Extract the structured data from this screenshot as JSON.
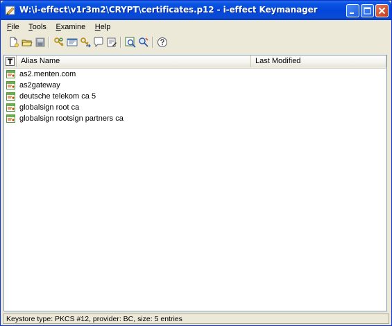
{
  "window": {
    "title": "W:\\i-effect\\v1r3m2\\CRYPT\\certificates.p12 - i-effect Keymanager"
  },
  "menu": {
    "items": [
      {
        "label": "File",
        "key": "F",
        "rest": "ile"
      },
      {
        "label": "Tools",
        "key": "T",
        "rest": "ools"
      },
      {
        "label": "Examine",
        "key": "E",
        "rest": "xamine"
      },
      {
        "label": "Help",
        "key": "H",
        "rest": "elp"
      }
    ]
  },
  "toolbar": {
    "icons": [
      "new-keystore-icon",
      "open-keystore-icon",
      "save-keystore-icon",
      "generate-keypair-icon",
      "import-certificate-icon",
      "import-keypair-icon",
      "keystore-report-icon",
      "set-password-icon",
      "examine-certificate-icon",
      "examine-ssl-icon",
      "help-icon"
    ]
  },
  "table": {
    "header_icon": "T",
    "columns": [
      "Alias Name",
      "Last Modified"
    ],
    "rows": [
      {
        "alias": "as2.menten.com",
        "modified": ""
      },
      {
        "alias": "as2gateway",
        "modified": ""
      },
      {
        "alias": "deutsche telekom ca 5",
        "modified": ""
      },
      {
        "alias": "globalsign root ca",
        "modified": ""
      },
      {
        "alias": "globalsign rootsign partners ca",
        "modified": ""
      }
    ]
  },
  "status": {
    "text": "Keystore type: PKCS #12, provider: BC, size: 5 entries"
  },
  "colors": {
    "titlebar": "#0a55e3",
    "close_button": "#c93a16",
    "chrome": "#ece9d8",
    "cert_icon": "#4f9a3a"
  }
}
